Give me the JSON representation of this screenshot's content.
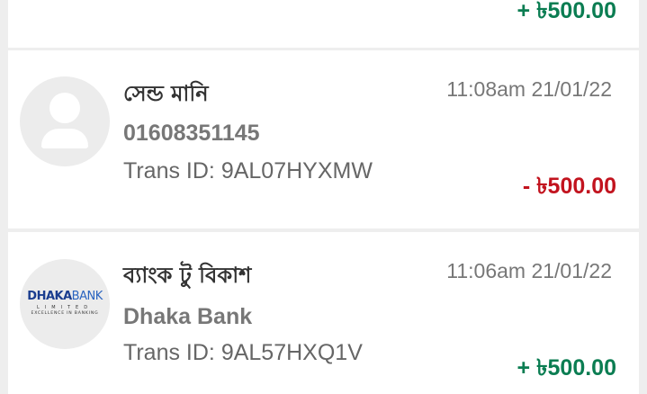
{
  "colors": {
    "background": "#eeeeee",
    "card": "#ffffff",
    "debit": "#c2131e",
    "credit": "#0b7d52",
    "title_text": "#333333",
    "muted_text": "#777777"
  },
  "transactions": [
    {
      "amount": "+ ৳500.00",
      "direction": "credit"
    },
    {
      "title": "সেন্ড মানি",
      "datetime": "11:08am 21/01/22",
      "subtitle": "01608351145",
      "trans_id_label": "Trans ID:",
      "trans_id": "9AL07HYXMW",
      "amount": "- ৳500.00",
      "direction": "debit",
      "avatar_icon": "person-icon"
    },
    {
      "title": "ব্যাংক টু বিকাশ",
      "datetime": "11:06am 21/01/22",
      "subtitle": "Dhaka Bank",
      "trans_id_label": "Trans ID:",
      "trans_id": "9AL57HXQ1V",
      "amount": "+ ৳500.00",
      "direction": "credit",
      "logo": {
        "brand_bold": "DHAKA",
        "brand_light": "BANK",
        "line2": "LIMITED",
        "tagline": "EXCELLENCE IN BANKING"
      }
    }
  ]
}
